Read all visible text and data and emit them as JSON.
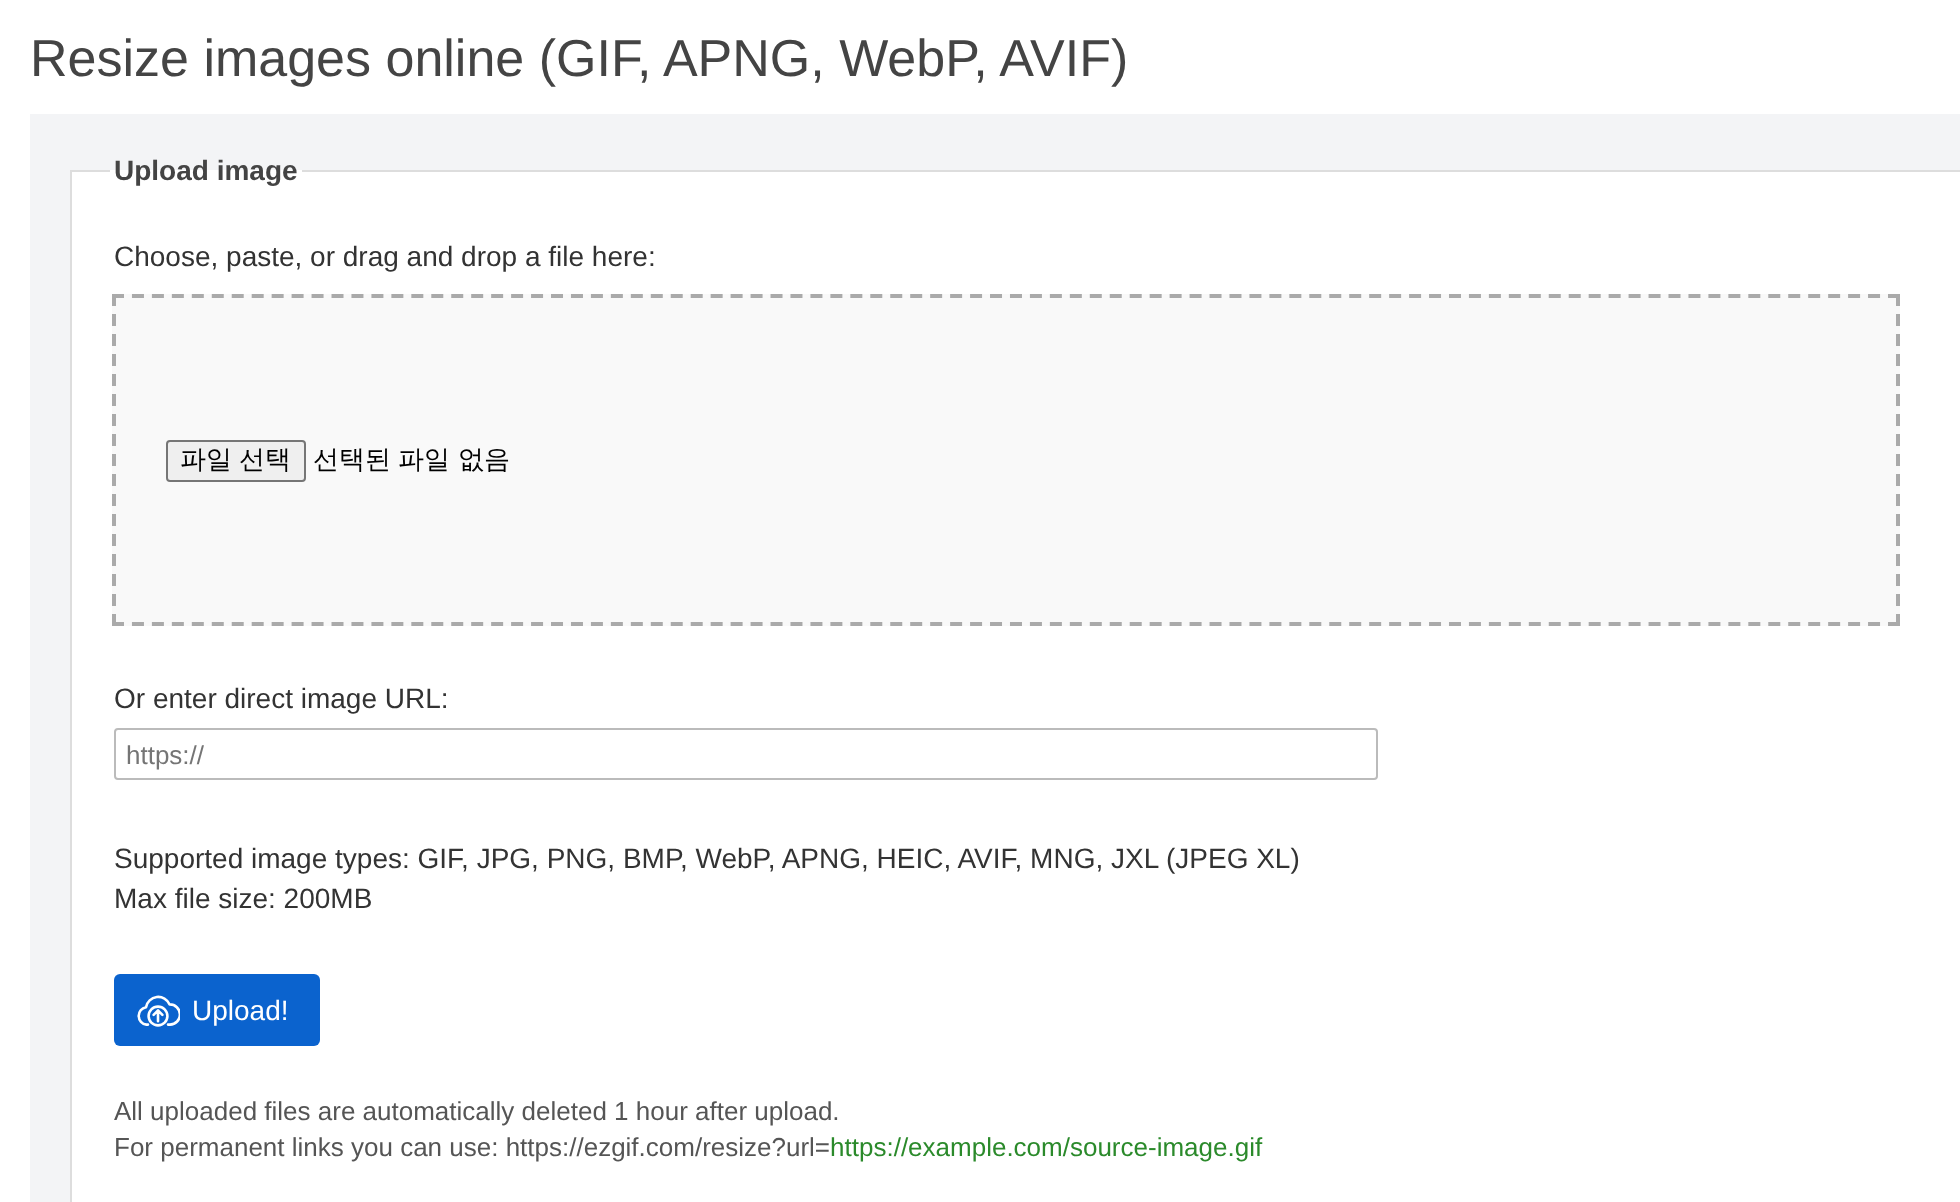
{
  "page": {
    "title": "Resize images online (GIF, APNG, WebP, AVIF)"
  },
  "upload_form": {
    "legend": "Upload image",
    "dropzone_label": "Choose, paste, or drag and drop a file here:",
    "file_input": {
      "button": "파일 선택",
      "status": "선택된 파일 없음"
    },
    "url_label": "Or enter direct image URL:",
    "url_field": {
      "placeholder": "https://"
    },
    "info_lines": [
      "Supported image types: GIF, JPG, PNG, BMP, WebP, APNG, HEIC, AVIF, MNG, JXL (JPEG XL)",
      "Max file size: 200MB"
    ],
    "upload_button": "Upload!",
    "notes": [
      {
        "text": "All uploaded files are automatically deleted 1 hour after upload."
      },
      {
        "text": "For permanent links you can use: https://ezgif.com/resize?url=",
        "example": "https://example.com/source-image.gif"
      }
    ]
  }
}
